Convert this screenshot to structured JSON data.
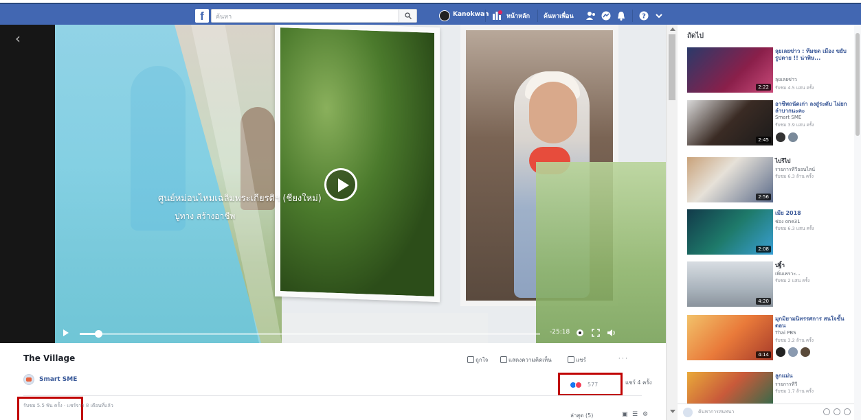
{
  "topbar": {
    "logo": "f",
    "search_placeholder": "ค้นหา",
    "user_name": "Kanokwan",
    "home_label": "หน้าหลัก",
    "find_friends_label": "ค้นหาเพื่อน",
    "accent": "#4267b2"
  },
  "video": {
    "overlay_title": "ศูนย์หม่อนไหมเฉลิมพระเกียรติฯ (ชียงใหม่)",
    "overlay_subtitle": "ปูทาง สร้างอาชีพ",
    "time_remaining": "-25:18",
    "progress_fraction": 0.04
  },
  "info": {
    "title": "The Village",
    "like_label": "ถูกใจ",
    "comment_label": "แสดงความคิดเห็น",
    "share_label": "แชร์",
    "page_name": "Smart SME",
    "reaction_count": "577",
    "share_count": "แชร์ 4 ครั้ง",
    "views": "รับชม 5.5 พัน ครั้ง · แชร์จาก 8 เดือนที่แล้ว",
    "comment_sort": "ล่าสุด (5)",
    "highlight_color": "#c00000"
  },
  "sidebar": {
    "heading": "ถัดไป",
    "items": [
      {
        "title": "ลุยเลยข่าว : ทีมขด เมือง ขยับรูปตาย !! น่าพิษ...",
        "page": "ลุยเลยข่าว",
        "views": "รับชม 4.5 แสน ครั้ง",
        "duration": "2:22"
      },
      {
        "title": "อาชีพถนัดเก่า ลงสู่ระดับ ไม่ยกลำบากนะคะ",
        "page": "Smart SME",
        "views": "รับชม 3.9 แสน ครั้ง",
        "duration": "2:45"
      },
      {
        "title": "ไปรีไป",
        "page": "รายการทีวีออนไลน์",
        "views": "รับชม 6.3 ล้าน ครั้ง",
        "duration": "2:56"
      },
      {
        "title": "เมีย 2018",
        "page": "ช่อง one31",
        "views": "รับชม 6.3 แสน ครั้ง",
        "duration": "2:08"
      },
      {
        "title": "ปฐิ้า",
        "page": "เพิ่มเพราะ...",
        "views": "รับชม 2 แสน ครั้ง",
        "duration": "4:20"
      },
      {
        "title": "มุกมิยามนิทรรศการ สนใจขั้นตอน",
        "page": "Thai PBS",
        "views": "รับชม 3.2 ล้าน ครั้ง",
        "duration": "4:14"
      },
      {
        "title": "ลูกแม่น",
        "page": "รายการทีวี",
        "views": "รับชม 1.7 ล้าน ครั้ง",
        "duration": ""
      }
    ]
  },
  "chat": {
    "placeholder": "ค้นหาการสนทนา"
  }
}
